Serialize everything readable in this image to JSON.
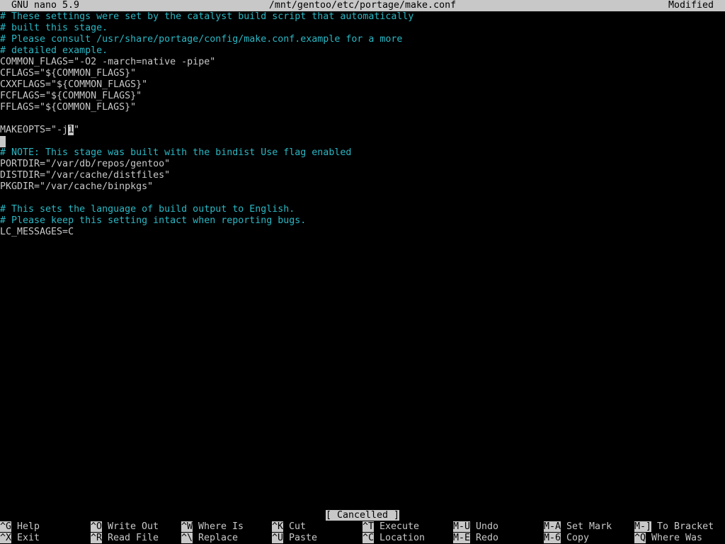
{
  "titlebar": {
    "app": "GNU nano 5.9",
    "file": "/mnt/gentoo/etc/portage/make.conf",
    "state": "Modified"
  },
  "editor": {
    "lines": [
      {
        "text": "# These settings were set by the catalyst build script that automatically",
        "kind": "comment"
      },
      {
        "text": "# built this stage.",
        "kind": "comment"
      },
      {
        "text": "# Please consult /usr/share/portage/config/make.conf.example for a more",
        "kind": "comment"
      },
      {
        "text": "# detailed example.",
        "kind": "comment"
      },
      {
        "text": "COMMON_FLAGS=\"-O2 -march=native -pipe\"",
        "kind": "code"
      },
      {
        "text": "CFLAGS=\"${COMMON_FLAGS}\"",
        "kind": "code"
      },
      {
        "text": "CXXFLAGS=\"${COMMON_FLAGS}\"",
        "kind": "code"
      },
      {
        "text": "FCFLAGS=\"${COMMON_FLAGS}\"",
        "kind": "code"
      },
      {
        "text": "FFLAGS=\"${COMMON_FLAGS}\"",
        "kind": "code"
      },
      {
        "text": "",
        "kind": "code"
      },
      {
        "text": "MAKEOPTS=\"-j1\"",
        "kind": "code"
      },
      {
        "text": "",
        "kind": "code"
      },
      {
        "text": "# NOTE: This stage was built with the bindist Use flag enabled",
        "kind": "comment"
      },
      {
        "text": "PORTDIR=\"/var/db/repos/gentoo\"",
        "kind": "code"
      },
      {
        "text": "DISTDIR=\"/var/cache/distfiles\"",
        "kind": "code"
      },
      {
        "text": "PKGDIR=\"/var/cache/binpkgs\"",
        "kind": "code"
      },
      {
        "text": "",
        "kind": "code"
      },
      {
        "text": "# This sets the language of build output to English.",
        "kind": "comment"
      },
      {
        "text": "# Please keep this setting intact when reporting bugs.",
        "kind": "comment"
      },
      {
        "text": "LC_MESSAGES=C",
        "kind": "code"
      }
    ]
  },
  "status_message": "[ Cancelled ]",
  "shortcuts": {
    "row1": [
      {
        "key": "^G",
        "label": "Help"
      },
      {
        "key": "^O",
        "label": "Write Out"
      },
      {
        "key": "^W",
        "label": "Where Is"
      },
      {
        "key": "^K",
        "label": "Cut"
      },
      {
        "key": "^T",
        "label": "Execute"
      },
      {
        "key": "M-U",
        "label": "Undo"
      },
      {
        "key": "M-A",
        "label": "Set Mark"
      },
      {
        "key": "M-]",
        "label": "To Bracket"
      }
    ],
    "row2": [
      {
        "key": "^X",
        "label": "Exit"
      },
      {
        "key": "^R",
        "label": "Read File"
      },
      {
        "key": "^\\",
        "label": "Replace"
      },
      {
        "key": "^U",
        "label": "Paste"
      },
      {
        "key": "^C",
        "label": "Location"
      },
      {
        "key": "M-E",
        "label": "Redo"
      },
      {
        "key": "M-6",
        "label": "Copy"
      },
      {
        "key": "^Q",
        "label": "Where Was"
      }
    ]
  },
  "colors": {
    "comment": "#2ab7c4",
    "text": "#c8c8c8",
    "background": "#000000",
    "inverse_bg": "#c8c8c8"
  }
}
